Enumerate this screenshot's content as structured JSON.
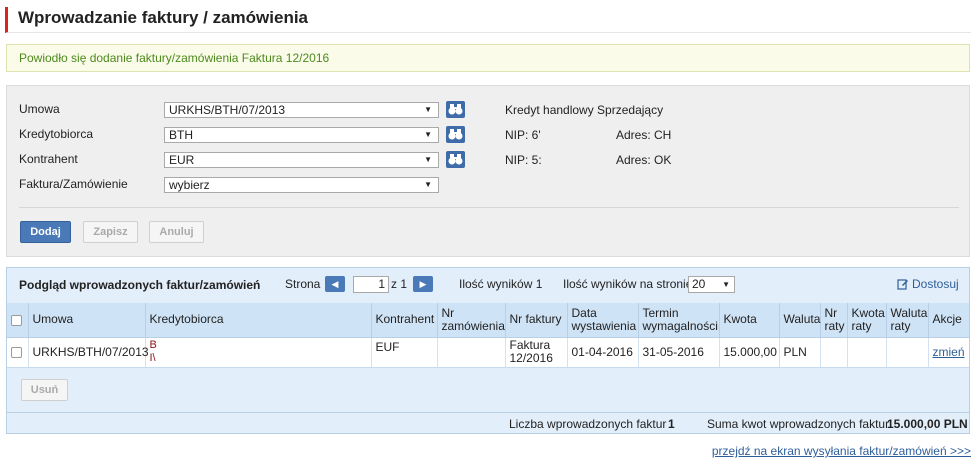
{
  "page": {
    "title": "Wprowadzanie faktury / zamówienia",
    "success_message": "Powiodło się dodanie faktury/zamówienia Faktura 12/2016"
  },
  "form": {
    "fields": [
      {
        "label": "Umowa",
        "value": "URKHS/BTH/07/2013"
      },
      {
        "label": "Kredytobiorca",
        "value": "BTH"
      },
      {
        "label": "Kontrahent",
        "value": "EUR"
      },
      {
        "label": "Faktura/Zamówienie",
        "value": "wybierz"
      }
    ],
    "info": {
      "credit_type": "Kredyt handlowy Sprzedający",
      "nip_1": "NIP: 6'",
      "address_1": "Adres: CH",
      "nip_2": "NIP: 5:",
      "address_2": "Adres: OK"
    },
    "buttons": {
      "add": "Dodaj",
      "save": "Zapisz",
      "cancel": "Anuluj"
    }
  },
  "list": {
    "title": "Podgląd wprowadzonych faktur/zamówień",
    "page_label": "Strona",
    "page_value": "1",
    "page_of": "z 1",
    "results_count": "Ilość wyników 1",
    "per_page_label": "Ilość wyników na stronie",
    "per_page_value": "20",
    "customize": "Dostosuj",
    "columns": [
      "Umowa",
      "Kredytobiorca",
      "Kontrahent",
      "Nr zamówienia",
      "Nr faktury",
      "Data wystawienia",
      "Termin wymagalności",
      "Kwota",
      "Waluta",
      "Nr raty",
      "Kwota raty",
      "Waluta raty",
      "Akcje"
    ],
    "rows": [
      {
        "umowa": "URKHS/BTH/07/2013",
        "kredytobiorca_1": "B",
        "kredytobiorca_2": "I\\",
        "kontrahent": "EUF",
        "nr_zamowienia": "",
        "nr_faktury": "Faktura 12/2016",
        "data_wystawienia": "01-04-2016",
        "termin": "31-05-2016",
        "kwota": "15.000,00",
        "waluta": "PLN",
        "nr_raty": "",
        "kwota_raty": "",
        "waluta_raty": "",
        "akcje": "zmień"
      }
    ],
    "delete_button": "Usuń",
    "footer": {
      "count_label": "Liczba wprowadzonych faktur",
      "count_value": "1",
      "sum_label": "Suma kwot wprowadzonych faktur",
      "sum_value": "15.000,00 PLN"
    }
  },
  "bottom_link": "przejdź na ekran wysyłania faktur/zamówień >>>",
  "colors": {
    "accent": "#d9251c",
    "primary": "#4a79b8",
    "success": "#4d8a1e"
  }
}
